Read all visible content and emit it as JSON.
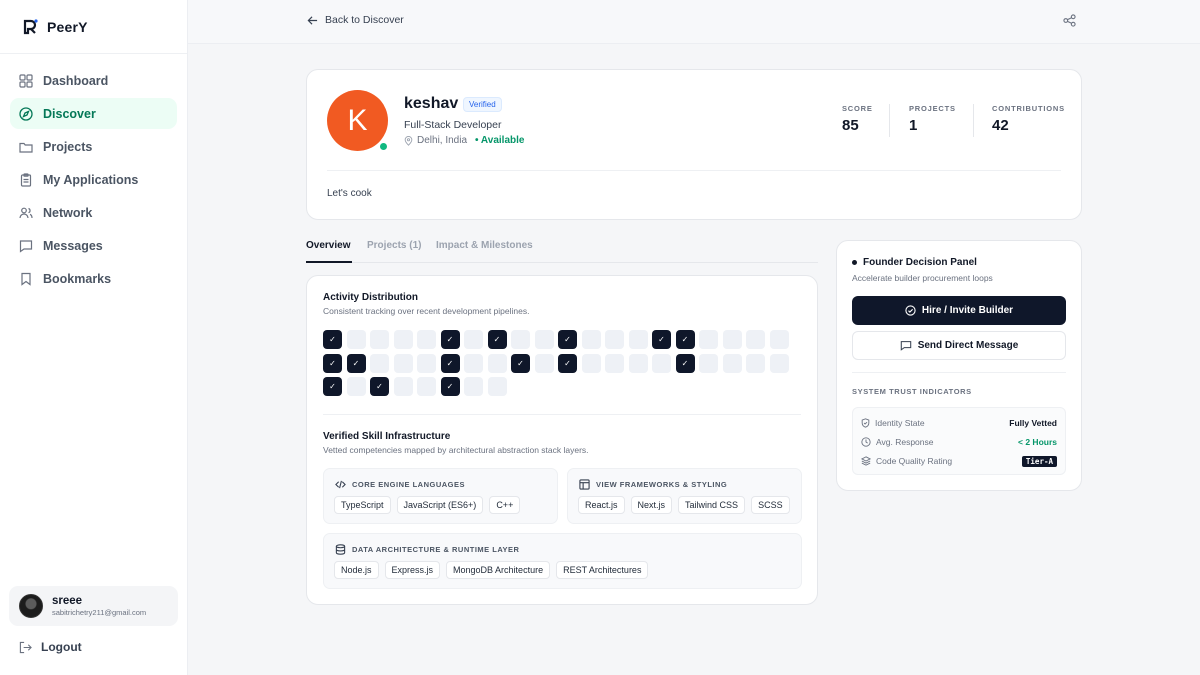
{
  "brand": {
    "name": "PeerY"
  },
  "sidebar": {
    "items": [
      {
        "label": "Dashboard",
        "icon": "dashboard-icon"
      },
      {
        "label": "Discover",
        "icon": "compass-icon",
        "active": true
      },
      {
        "label": "Projects",
        "icon": "folder-icon"
      },
      {
        "label": "My Applications",
        "icon": "clipboard-icon"
      },
      {
        "label": "Network",
        "icon": "users-icon"
      },
      {
        "label": "Messages",
        "icon": "message-icon"
      },
      {
        "label": "Bookmarks",
        "icon": "bookmark-icon"
      }
    ],
    "user": {
      "name": "sreee",
      "email": "sabitrichetry211@gmail.com"
    },
    "logout_label": "Logout"
  },
  "topbar": {
    "back_label": "Back to Discover"
  },
  "profile": {
    "initial": "K",
    "name": "keshav",
    "verified_label": "Verified",
    "role": "Full-Stack Developer",
    "location": "Delhi, India",
    "availability": "Available",
    "bio": "Let's cook",
    "stats": [
      {
        "label": "SCORE",
        "value": "85"
      },
      {
        "label": "PROJECTS",
        "value": "1"
      },
      {
        "label": "CONTRIBUTIONS",
        "value": "42"
      }
    ],
    "avatar_color": "#f15a22",
    "online_color": "#10b981"
  },
  "tabs": [
    {
      "label": "Overview",
      "active": true
    },
    {
      "label": "Projects (1)"
    },
    {
      "label": "Impact & Milestones"
    }
  ],
  "activity": {
    "title": "Activity Distribution",
    "subtitle": "Consistent tracking over recent development pipelines.",
    "check_glyph": "✓",
    "rows": [
      [
        1,
        0,
        0,
        0,
        0,
        1,
        0,
        1,
        0,
        0,
        1,
        0,
        0,
        0,
        1,
        1,
        0,
        0,
        0,
        0
      ],
      [
        1,
        1,
        0,
        0,
        0,
        1,
        0,
        0,
        1,
        0,
        1,
        0,
        0,
        0,
        0,
        1,
        0,
        0,
        0,
        0
      ],
      [
        1,
        0,
        1,
        0,
        0,
        1,
        0,
        0
      ]
    ]
  },
  "skills": {
    "title": "Verified Skill Infrastructure",
    "subtitle": "Vetted competencies mapped by architectural abstraction stack layers.",
    "groups": [
      {
        "title": "CORE ENGINE LANGUAGES",
        "icon": "code-icon",
        "items": [
          "TypeScript",
          "JavaScript (ES6+)",
          "C++"
        ]
      },
      {
        "title": "VIEW FRAMEWORKS & STYLING",
        "icon": "layout-icon",
        "items": [
          "React.js",
          "Next.js",
          "Tailwind CSS",
          "SCSS"
        ]
      },
      {
        "title": "DATA ARCHITECTURE & RUNTIME LAYER",
        "icon": "database-icon",
        "items": [
          "Node.js",
          "Express.js",
          "MongoDB Architecture",
          "REST Architectures"
        ]
      }
    ]
  },
  "panel": {
    "title": "Founder Decision Panel",
    "subtitle": "Accelerate builder procurement loops",
    "primary_label": "Hire / Invite Builder",
    "secondary_label": "Send Direct Message",
    "trust_title": "SYSTEM TRUST INDICATORS",
    "trust": [
      {
        "key": "Identity State",
        "value": "Fully Vetted",
        "icon": "shield-icon"
      },
      {
        "key": "Avg. Response",
        "value": "< 2 Hours",
        "icon": "clock-icon"
      },
      {
        "key": "Code Quality Rating",
        "value": "Tier-A",
        "icon": "layers-icon"
      }
    ]
  },
  "colors": {
    "accent": "#047857",
    "dark": "#0f172a",
    "success": "#059669"
  }
}
